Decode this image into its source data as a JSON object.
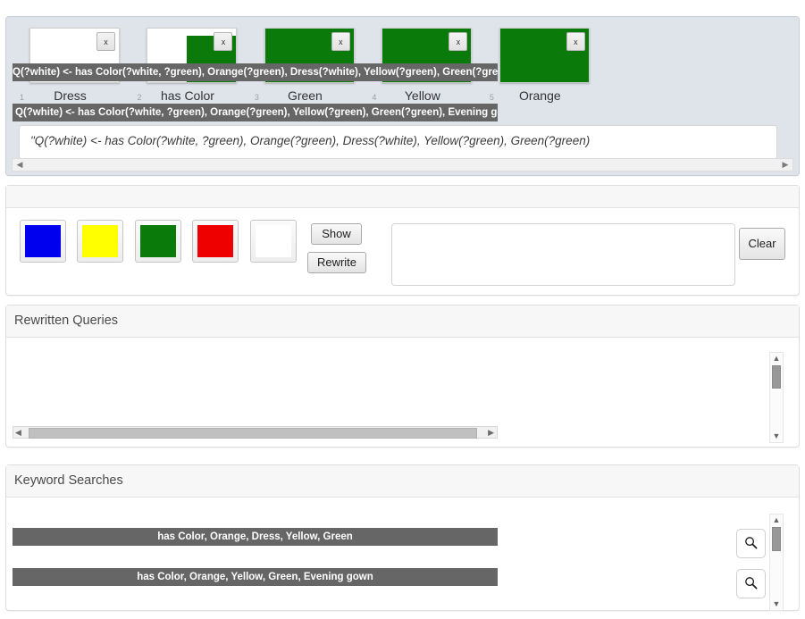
{
  "top_panel": {
    "thumbnails": [
      {
        "index": "1",
        "caption": "Dress",
        "fill": "none",
        "close_label": "x"
      },
      {
        "index": "2",
        "caption": "has Color",
        "fill": "right",
        "close_label": "x"
      },
      {
        "index": "3",
        "caption": "Green",
        "fill": "full",
        "close_label": "x"
      },
      {
        "index": "4",
        "caption": "Yellow",
        "fill": "full",
        "close_label": "x"
      },
      {
        "index": "5",
        "caption": "Orange",
        "fill": "full",
        "close_label": "x"
      }
    ],
    "query_text": "\"Q(?white) <- has Color(?white, ?green), Orange(?green), Dress(?white), Yellow(?green), Green(?green)",
    "scroll_left_icon": "◀",
    "scroll_right_icon": "▶"
  },
  "controls": {
    "colors": [
      {
        "name": "blue-swatch",
        "hex": "#0000ee"
      },
      {
        "name": "yellow-swatch",
        "hex": "#ffff00"
      },
      {
        "name": "green-swatch",
        "hex": "#0a7a0a"
      },
      {
        "name": "red-swatch",
        "hex": "#ee0000"
      },
      {
        "name": "white-swatch",
        "hex": "#ffffff"
      }
    ],
    "show_label": "Show",
    "rewrite_label": "Rewrite",
    "clear_label": "Clear",
    "textarea_value": "",
    "textarea_placeholder": ""
  },
  "rewritten": {
    "title": "Rewritten Queries",
    "items": [
      "Q(?white) <- has Color(?white, ?green), Orange(?green), Dress(?white), Yellow(?green), Green(?green)",
      "Q(?white) <- has Color(?white, ?green), Orange(?green), Yellow(?green), Green(?green), Evening gown(?white"
    ],
    "hscroll_left_icon": "◀",
    "hscroll_right_icon": "▶",
    "vscroll_up_icon": "▲",
    "vscroll_down_icon": "▼"
  },
  "keyword": {
    "title": "Keyword Searches",
    "items": [
      "has Color, Orange, Dress, Yellow, Green",
      "has Color, Orange, Yellow, Green, Evening gown"
    ],
    "search_icon_name": "magnifier-icon",
    "vscroll_up_icon": "▲",
    "vscroll_down_icon": "▼"
  },
  "theme": {
    "panel_bg": "#ffffff",
    "top_panel_bg": "#dfe3ea",
    "bar_bg": "#666666",
    "green": "#0a7a0a"
  }
}
